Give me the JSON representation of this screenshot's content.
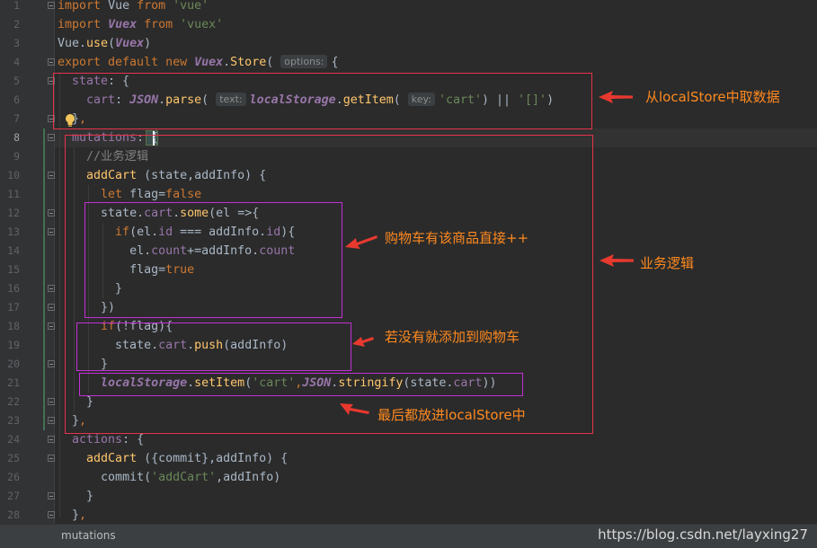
{
  "editor": {
    "line_numbers": [
      "1",
      "2",
      "3",
      "4",
      "5",
      "6",
      "7",
      "8",
      "9",
      "10",
      "11",
      "12",
      "13",
      "14",
      "15",
      "16",
      "17",
      "18",
      "19",
      "20",
      "21",
      "22",
      "23",
      "24",
      "25",
      "26",
      "27",
      "28"
    ],
    "current_line": "8",
    "hints": {
      "options": "options:",
      "text": "text:",
      "key": "key:"
    },
    "code": {
      "t1": [
        "import",
        "Vue",
        "from",
        "'vue'",
        "Vuex",
        "'vuex'"
      ],
      "t3": [
        "Vue.",
        "use",
        "(",
        "Vuex",
        ")"
      ],
      "t4": [
        "export default new",
        "Vuex",
        ".",
        "Store",
        "(",
        "{"
      ],
      "t5": [
        "state",
        ": {"
      ],
      "t6": [
        "cart",
        ": ",
        "JSON",
        ".",
        "parse",
        "(",
        "localStorage",
        ".",
        "getItem",
        "(",
        "'cart'",
        ") || ",
        "'[]'",
        ")"
      ],
      "t7": [
        "}",
        ","
      ],
      "t8": [
        "mutations",
        ": ",
        "{"
      ],
      "t9": "//业务逻辑",
      "t10": [
        "addCart",
        " (state,addInfo) {"
      ],
      "t11": [
        "let",
        " flag=",
        "false"
      ],
      "t12": [
        "state.",
        "cart",
        ".",
        "some",
        "(el =>{"
      ],
      "t13": [
        "if",
        "(el.",
        "id",
        " === addInfo.",
        "id",
        "){"
      ],
      "t14": [
        "el.",
        "count",
        "+=addInfo.",
        "count"
      ],
      "t15": [
        "flag=",
        "true"
      ],
      "t16": "}",
      "t17": "})",
      "t18": [
        "if",
        "(!flag){"
      ],
      "t19": [
        "state.",
        "cart",
        ".",
        "push",
        "(addInfo)"
      ],
      "t20": "}",
      "t21": [
        "localStorage",
        ".",
        "setItem",
        "(",
        "'cart'",
        ",",
        "JSON",
        ".",
        "stringify",
        "(state.",
        "cart",
        "))"
      ],
      "t22": "}",
      "t23": [
        "}",
        ","
      ],
      "t24": [
        "actions",
        ": {"
      ],
      "t25": [
        "addCart",
        " ({commit},addInfo) {"
      ],
      "t26": [
        "commit(",
        "'addCart'",
        ",addInfo)"
      ],
      "t27": "}",
      "t28": [
        "}",
        ","
      ]
    }
  },
  "annotations": {
    "a1": "从localStore中取数据",
    "a2": "购物车有该商品直接++",
    "a3": "业务逻辑",
    "a4": "若没有就添加到购物车",
    "a5": "最后都放进localStore中"
  },
  "colors": {
    "annotation_text": "#ff8a1f",
    "red_box": "#e5334b",
    "magenta_box": "#c32fd6",
    "arrow": "#e8392f"
  },
  "status": {
    "breadcrumb": "mutations"
  },
  "watermark": "https://blog.csdn.net/layxing27"
}
